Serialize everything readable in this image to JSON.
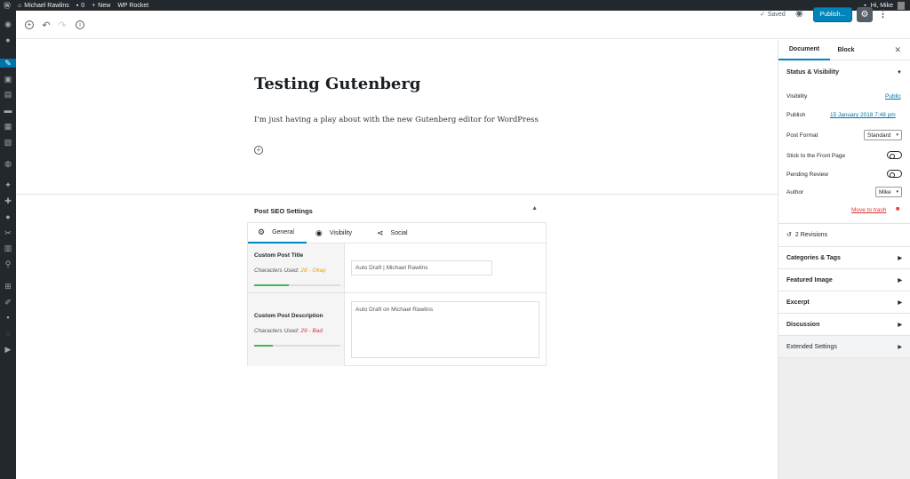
{
  "admin_bar": {
    "site_name": "Michael Rawlins",
    "comments_count": "0",
    "new_label": "New",
    "plugin_label": "WP Rocket",
    "greeting": "Hi, Mike"
  },
  "admin_menu": {
    "icons": [
      "dashboard-icon",
      "jetpack-icon",
      "posts-icon",
      "media-icon",
      "pages-icon",
      "comments-icon",
      "feedback-icon",
      "forms-icon",
      "woocommerce-icon",
      "appearance-icon",
      "plugins-icon",
      "users-icon",
      "tools-icon",
      "settings-icon",
      "seo-icon",
      "layouts-icon",
      "editor-icon",
      "camera-icon",
      "shield-icon",
      "play-icon"
    ]
  },
  "toolbar": {
    "saved_label": "Saved",
    "publish_label": "Publish..."
  },
  "post": {
    "title": "Testing Gutenberg",
    "paragraph": "I'm just having a play about with the new Gutenberg editor for WordPress"
  },
  "seo": {
    "header": "Post SEO Settings",
    "tabs": [
      {
        "label": "General"
      },
      {
        "label": "Visibility"
      },
      {
        "label": "Social"
      }
    ],
    "fields": [
      {
        "title": "Custom Post Title",
        "chars_prefix": "Characters Used: ",
        "chars_value": "28 - Okay",
        "value": "Auto Draft | Michael Rawlins",
        "progress": 0.4
      },
      {
        "title": "Custom Post Description",
        "chars_prefix": "Characters Used: ",
        "chars_value": "29 - Bad",
        "value": "Auto Draft on Michael Rawlins",
        "progress": 0.22
      }
    ]
  },
  "sidebar": {
    "tabs": [
      {
        "label": "Document"
      },
      {
        "label": "Block"
      }
    ],
    "status_visibility": {
      "header": "Status & Visibility",
      "visibility_label": "Visibility",
      "visibility_value": "Public",
      "publish_label": "Publish",
      "publish_value": "15 January 2018 7:48 pm",
      "format_label": "Post Format",
      "format_value": "Standard",
      "sticky_label": "Stick to the Front Page",
      "pending_label": "Pending Review",
      "author_label": "Author",
      "author_value": "Mike",
      "trash_label": "Move to trash"
    },
    "revisions": "2 Revisions",
    "panels": [
      {
        "label": "Categories & Tags"
      },
      {
        "label": "Featured Image"
      },
      {
        "label": "Excerpt"
      },
      {
        "label": "Discussion"
      },
      {
        "label": "Extended Settings"
      }
    ]
  },
  "colors": {
    "accent": "#0085ba",
    "admin_bg": "#23282d",
    "okay": "#f0a000",
    "bad": "#dc3232",
    "progress": "#46b450"
  }
}
